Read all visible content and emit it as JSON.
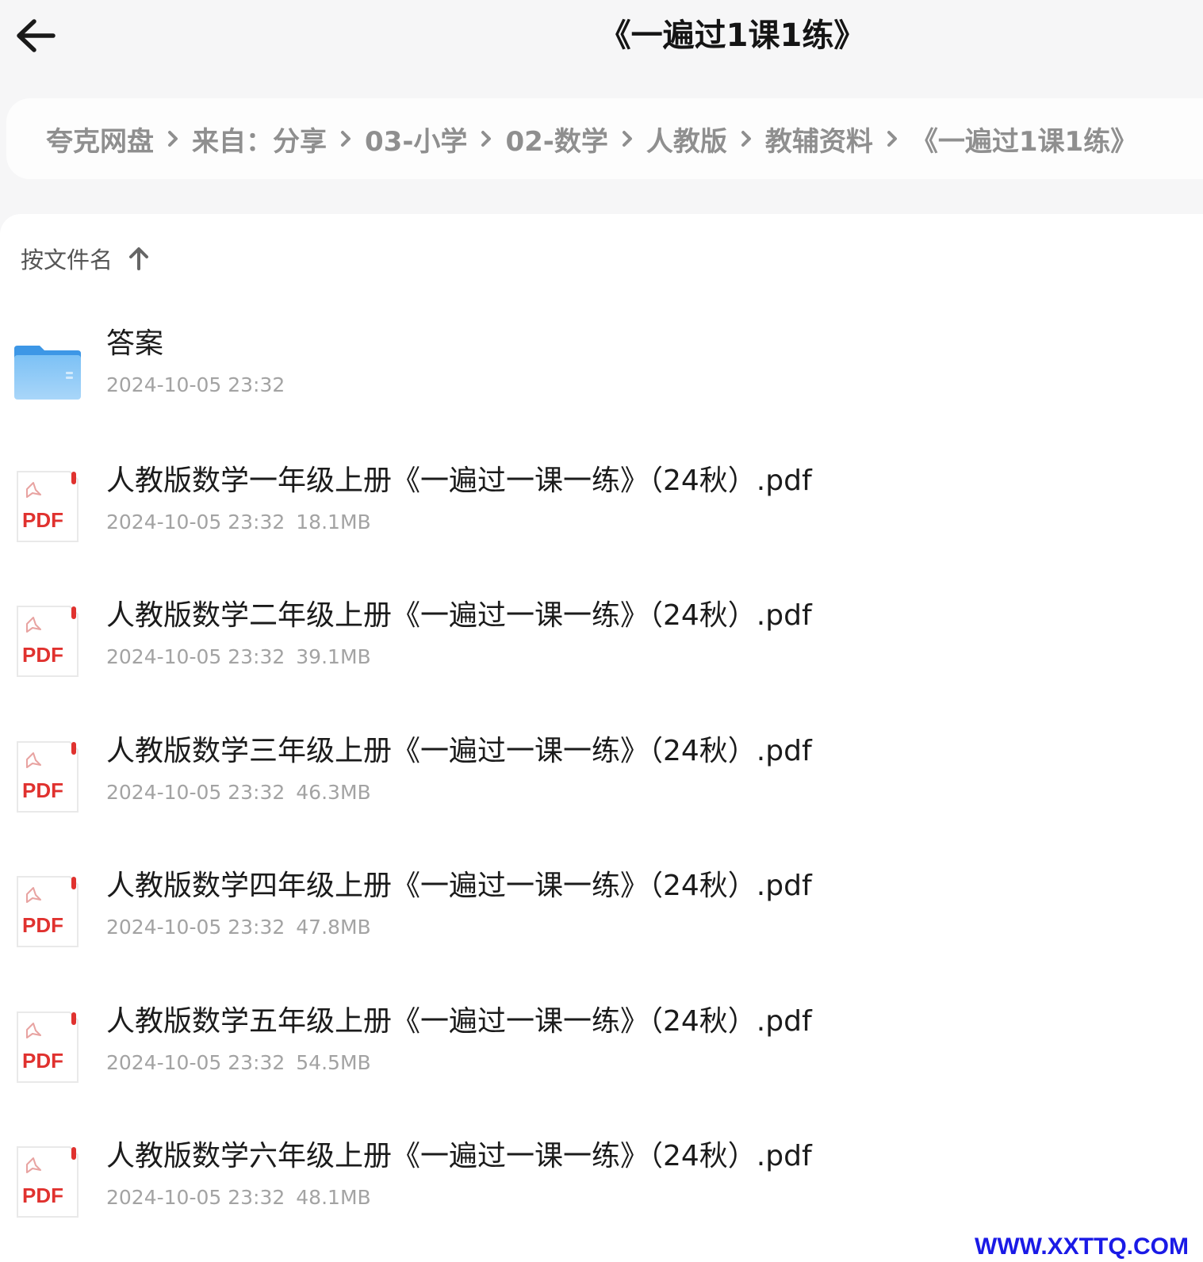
{
  "header": {
    "back_icon": "arrow-left-icon",
    "title": "《一遍过1课1练》"
  },
  "breadcrumb": {
    "separator_icon": "chevron-right-icon",
    "items": [
      {
        "label": "夸克网盘"
      },
      {
        "label": "来自：分享"
      },
      {
        "label": "03-小学"
      },
      {
        "label": "02-数学"
      },
      {
        "label": "人教版"
      },
      {
        "label": "教辅资料"
      },
      {
        "label": "《一遍过1课1练》"
      }
    ]
  },
  "sort": {
    "label": "按文件名",
    "direction_icon": "arrow-up-icon"
  },
  "files": [
    {
      "type": "folder",
      "icon": "folder-icon",
      "name": "答案",
      "date": "2024-10-05 23:32",
      "size": ""
    },
    {
      "type": "pdf",
      "icon": "pdf-file-icon",
      "badge": "PDF",
      "name": "人教版数学一年级上册《一遍过一课一练》（24秋）.pdf",
      "date": "2024-10-05 23:32",
      "size": "18.1MB"
    },
    {
      "type": "pdf",
      "icon": "pdf-file-icon",
      "badge": "PDF",
      "name": "人教版数学二年级上册《一遍过一课一练》（24秋）.pdf",
      "date": "2024-10-05 23:32",
      "size": "39.1MB"
    },
    {
      "type": "pdf",
      "icon": "pdf-file-icon",
      "badge": "PDF",
      "name": "人教版数学三年级上册《一遍过一课一练》（24秋）.pdf",
      "date": "2024-10-05 23:32",
      "size": "46.3MB"
    },
    {
      "type": "pdf",
      "icon": "pdf-file-icon",
      "badge": "PDF",
      "name": "人教版数学四年级上册《一遍过一课一练》（24秋）.pdf",
      "date": "2024-10-05 23:32",
      "size": "47.8MB"
    },
    {
      "type": "pdf",
      "icon": "pdf-file-icon",
      "badge": "PDF",
      "name": "人教版数学五年级上册《一遍过一课一练》（24秋）.pdf",
      "date": "2024-10-05 23:32",
      "size": "54.5MB"
    },
    {
      "type": "pdf",
      "icon": "pdf-file-icon",
      "badge": "PDF",
      "name": "人教版数学六年级上册《一遍过一课一练》（24秋）.pdf",
      "date": "2024-10-05 23:32",
      "size": "48.1MB"
    }
  ],
  "watermark": "WWW.XXTTQ.COM",
  "colors": {
    "page_bg": "#f6f6f7",
    "panel_bg": "#ffffff",
    "breadcrumb_text": "#8f8f8f",
    "meta_text": "#a3a3a3",
    "folder_blue": "#4aa3ec",
    "pdf_red": "#e0322f",
    "watermark_blue": "#1a1ae6"
  }
}
